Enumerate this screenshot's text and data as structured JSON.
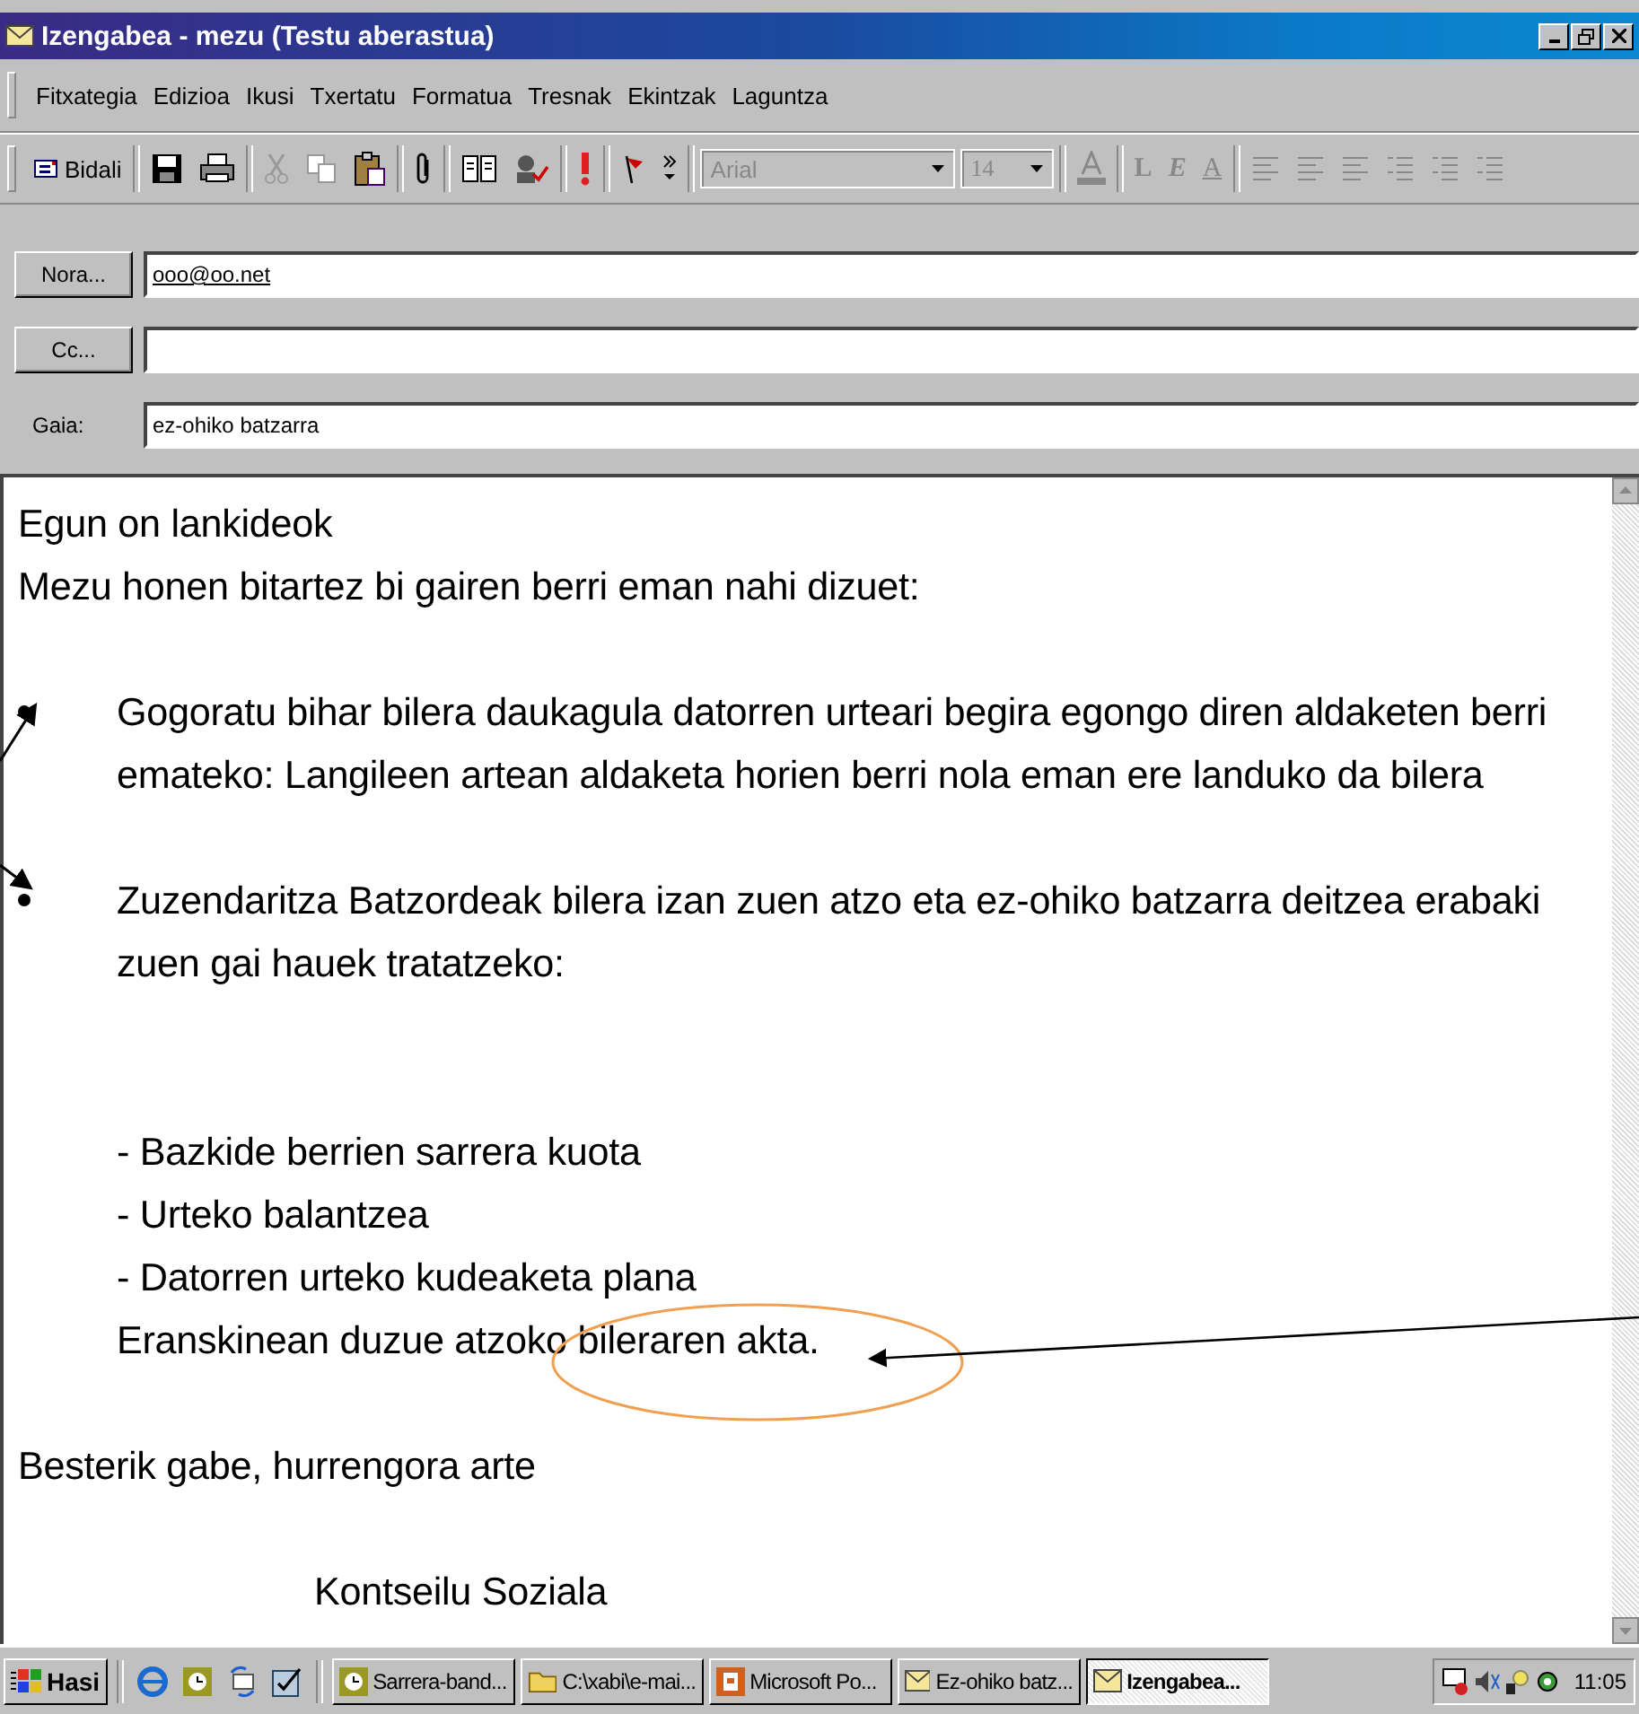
{
  "window": {
    "title": "Izengabea - mezu (Testu aberastua)"
  },
  "menu": [
    "Fitxategia",
    "Edizioa",
    "Ikusi",
    "Txertatu",
    "Formatua",
    "Tresnak",
    "Ekintzak",
    "Laguntza"
  ],
  "toolbar": {
    "send_label": "Bidali",
    "font": {
      "value": "Arial",
      "disabled": true
    },
    "size": {
      "value": "14",
      "disabled": true
    },
    "format_buttons": [
      "L",
      "E",
      "A"
    ]
  },
  "header": {
    "to_button": "Nora...",
    "to_value": "ooo@oo.net",
    "cc_button": "Cc...",
    "subject_label": "Gaia:",
    "subject_value": "ez-ohiko batzarra"
  },
  "body": [
    {
      "kind": "line",
      "text": "Egun on lankideok"
    },
    {
      "kind": "line",
      "text": "Mezu honen bitartez bi gairen berri eman nahi dizuet:"
    },
    {
      "kind": "bullet",
      "text": "Gogoratu bihar bilera daukagula datorren urteari begira egongo diren aldaketen berri emateko: Langileen artean aldaketa horien berri nola eman ere landuko da bilera"
    },
    {
      "kind": "bullet",
      "text": "Zuzendaritza Batzordeak bilera izan zuen atzo eta ez-ohiko batzarra deitzea erabaki zuen gai hauek tratatzeko:"
    },
    {
      "kind": "indent",
      "text": "- Bazkide berrien sarrera kuota"
    },
    {
      "kind": "indent",
      "text": "- Urteko balantzea"
    },
    {
      "kind": "indent",
      "text": "- Datorren urteko kudeaketa plana"
    },
    {
      "kind": "indent",
      "text": "Eranskinean duzue atzoko bileraren akta."
    },
    {
      "kind": "line",
      "text": "Besterik gabe, hurrengora arte"
    },
    {
      "kind": "signature",
      "text": "Kontseilu Soziala"
    }
  ],
  "taskbar": {
    "start_label": "Hasi",
    "tasks": [
      {
        "label": "Sarrera-band...",
        "kind": "clock",
        "selected": false
      },
      {
        "label": "C:\\xabi\\e-mai...",
        "kind": "folder",
        "selected": false
      },
      {
        "label": "Microsoft Po...",
        "kind": "slides",
        "selected": false
      },
      {
        "label": "Ez-ohiko batz...",
        "kind": "mail",
        "selected": false
      },
      {
        "label": "Izengabea...",
        "kind": "mail",
        "selected": true
      }
    ],
    "clock": "11:05"
  }
}
